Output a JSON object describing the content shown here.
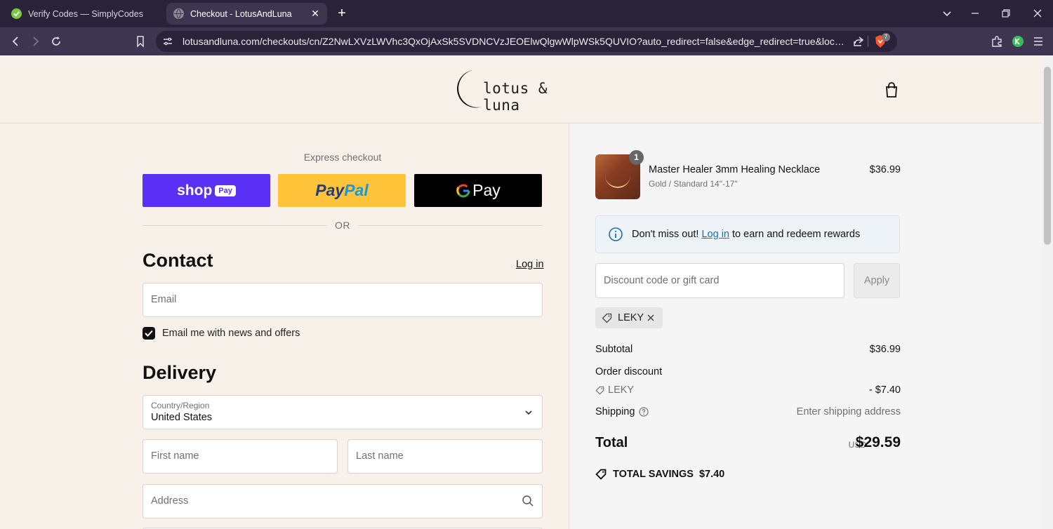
{
  "browser": {
    "tabs": [
      {
        "title": "Verify Codes — SimplyCodes"
      },
      {
        "title": "Checkout - LotusAndLuna"
      }
    ],
    "url": "lotusandluna.com/checkouts/cn/Z2NwLXVzLWVhc3QxOjAxSk5SVDNCVzJEOElwQlgwWlpWSk5QUVIO?auto_redirect=false&edge_redirect=true&locale=en-...",
    "brave_badge": "7"
  },
  "store": {
    "logo_text": "lotus & luna"
  },
  "express": {
    "title": "Express checkout",
    "shoppay_label": "shop",
    "shoppay_pill": "Pay",
    "paypal_a": "Pay",
    "paypal_b": "Pal",
    "gpay_label": "Pay",
    "or_text": "OR"
  },
  "contact": {
    "heading": "Contact",
    "login_label": "Log in",
    "email_placeholder": "Email",
    "news_label": "Email me with news and offers",
    "news_checked": true
  },
  "delivery": {
    "heading": "Delivery",
    "country_label": "Country/Region",
    "country_value": "United States",
    "first_name_placeholder": "First name",
    "last_name_placeholder": "Last name",
    "address_placeholder": "Address"
  },
  "order": {
    "item": {
      "quantity": "1",
      "name": "Master Healer 3mm Healing Necklace",
      "variant": "Gold / Standard 14\"-17\"",
      "price": "$36.99"
    },
    "banner": {
      "text_before": "Don't miss out!",
      "link": "Log in",
      "text_after": "to earn and redeem rewards"
    },
    "discount_placeholder": "Discount code or gift card",
    "apply_label": "Apply",
    "applied_code": "LEKY",
    "subtotal_label": "Subtotal",
    "subtotal_value": "$36.99",
    "order_discount_label": "Order discount",
    "discount_code": "LEKY",
    "discount_value": "- $7.40",
    "shipping_label": "Shipping",
    "shipping_value": "Enter shipping address",
    "total_label": "Total",
    "currency": "USD",
    "total_value": "$29.59",
    "savings_label": "TOTAL SAVINGS",
    "savings_value": "$7.40"
  },
  "colors": {
    "page_bg": "#f8f1ea",
    "shoppay": "#5a31f4",
    "paypal": "#ffc439",
    "link": "#1773b0"
  }
}
